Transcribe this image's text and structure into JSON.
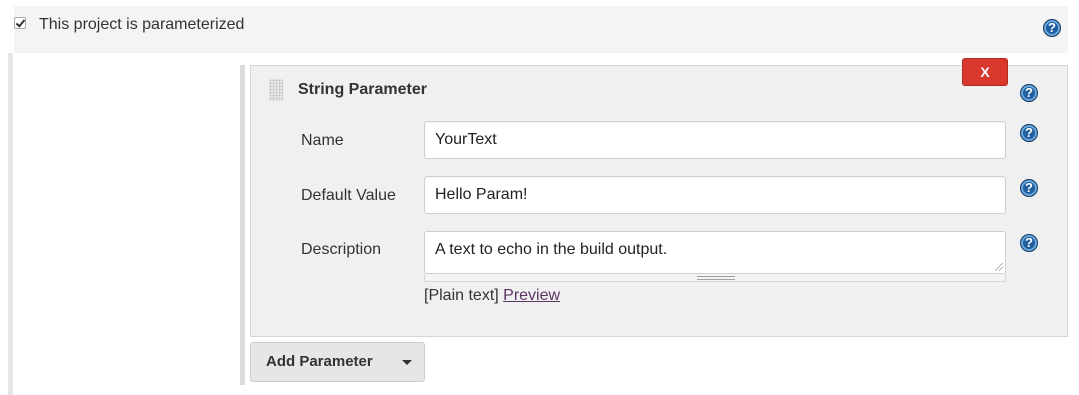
{
  "top": {
    "checked": true,
    "label": "This project is parameterized"
  },
  "param": {
    "title": "String Parameter",
    "delete_label": "X",
    "fields": {
      "name_label": "Name",
      "name_value": "YourText",
      "default_label": "Default Value",
      "default_value": "Hello Param!",
      "description_label": "Description",
      "description_value": "A text to echo in the build output."
    },
    "plain_text": "[Plain text]",
    "preview": "Preview"
  },
  "add_button": {
    "label": "Add Parameter"
  },
  "help_icon_glyph": "?",
  "colors": {
    "delete": "#d9382d",
    "help": "#1f5f9f",
    "link": "#5c3566"
  },
  "icons": [
    "checkbox-icon",
    "help-icon",
    "drag-handle-icon",
    "caret-down-icon"
  ]
}
